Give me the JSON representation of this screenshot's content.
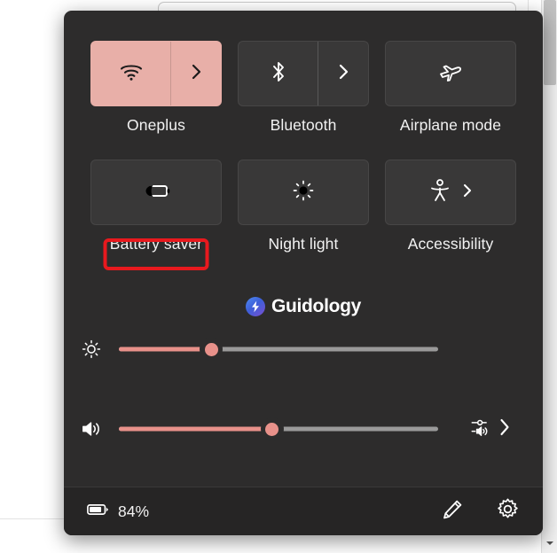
{
  "window": {
    "type": "windows-quick-settings-flyout",
    "panel_color": "#2d2c2c",
    "footer_color": "#262525",
    "accent_color": "#e8afa8",
    "slider_fill_color": "#e8918a",
    "annotation_color": "#e8191e"
  },
  "tiles": [
    {
      "id": "wifi",
      "label": "Oneplus",
      "icon": "wifi-icon",
      "state": "on",
      "has_chevron": true,
      "chevron_style": "split"
    },
    {
      "id": "bluetooth",
      "label": "Bluetooth",
      "icon": "bluetooth-icon",
      "state": "off",
      "has_chevron": true,
      "chevron_style": "split"
    },
    {
      "id": "airplane-mode",
      "label": "Airplane mode",
      "icon": "airplane-icon",
      "state": "off",
      "has_chevron": false,
      "chevron_style": "none"
    },
    {
      "id": "battery-saver",
      "label": "Battery saver",
      "icon": "battery-saver-icon",
      "state": "off",
      "has_chevron": false,
      "chevron_style": "none",
      "annotated": true
    },
    {
      "id": "night-light",
      "label": "Night light",
      "icon": "night-light-icon",
      "state": "off",
      "has_chevron": false,
      "chevron_style": "none"
    },
    {
      "id": "accessibility",
      "label": "Accessibility",
      "icon": "accessibility-icon",
      "state": "off",
      "has_chevron": true,
      "chevron_style": "inline"
    }
  ],
  "sliders": {
    "brightness": {
      "name": "Brightness",
      "icon": "brightness-icon",
      "value": 29,
      "min": 0,
      "max": 100
    },
    "volume": {
      "name": "Volume",
      "icon": "speaker-icon",
      "value": 48,
      "min": 0,
      "max": 100,
      "trailing_icon": "audio-output-selector-icon",
      "trailing_chevron": "chevron-right-icon"
    }
  },
  "footer": {
    "battery_icon": "battery-icon",
    "battery_percent": "84%",
    "edit_label": "Edit quick settings",
    "settings_label": "Settings"
  },
  "watermark": {
    "text": "Guidology",
    "logo": "lightning-bolt-icon"
  },
  "scrollbar": {
    "orientation": "vertical",
    "arrow": "chevron-down-icon"
  }
}
